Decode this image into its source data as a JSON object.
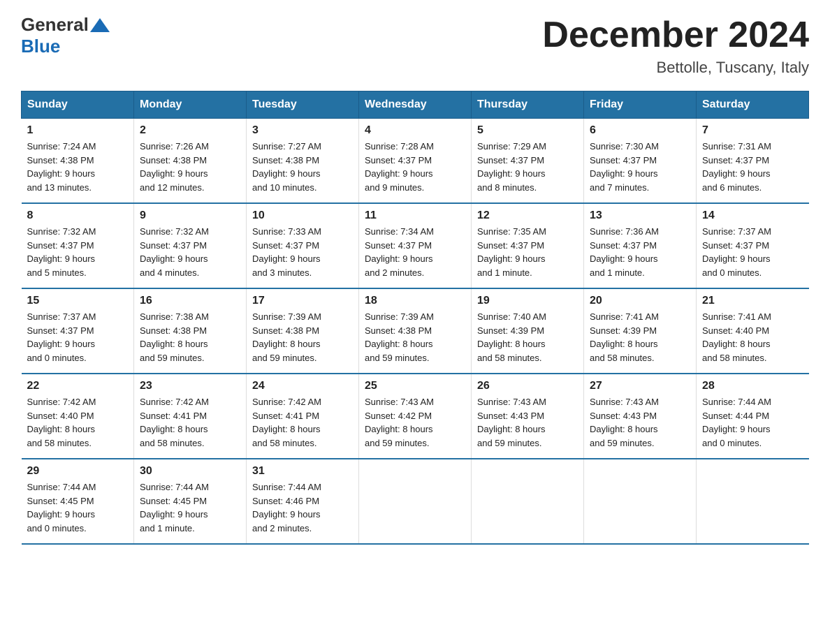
{
  "header": {
    "logo_general": "General",
    "logo_blue": "Blue",
    "month_title": "December 2024",
    "subtitle": "Bettolle, Tuscany, Italy"
  },
  "weekdays": [
    "Sunday",
    "Monday",
    "Tuesday",
    "Wednesday",
    "Thursday",
    "Friday",
    "Saturday"
  ],
  "weeks": [
    [
      {
        "day": "1",
        "sunrise": "7:24 AM",
        "sunset": "4:38 PM",
        "daylight": "9 hours and 13 minutes."
      },
      {
        "day": "2",
        "sunrise": "7:26 AM",
        "sunset": "4:38 PM",
        "daylight": "9 hours and 12 minutes."
      },
      {
        "day": "3",
        "sunrise": "7:27 AM",
        "sunset": "4:38 PM",
        "daylight": "9 hours and 10 minutes."
      },
      {
        "day": "4",
        "sunrise": "7:28 AM",
        "sunset": "4:37 PM",
        "daylight": "9 hours and 9 minutes."
      },
      {
        "day": "5",
        "sunrise": "7:29 AM",
        "sunset": "4:37 PM",
        "daylight": "9 hours and 8 minutes."
      },
      {
        "day": "6",
        "sunrise": "7:30 AM",
        "sunset": "4:37 PM",
        "daylight": "9 hours and 7 minutes."
      },
      {
        "day": "7",
        "sunrise": "7:31 AM",
        "sunset": "4:37 PM",
        "daylight": "9 hours and 6 minutes."
      }
    ],
    [
      {
        "day": "8",
        "sunrise": "7:32 AM",
        "sunset": "4:37 PM",
        "daylight": "9 hours and 5 minutes."
      },
      {
        "day": "9",
        "sunrise": "7:32 AM",
        "sunset": "4:37 PM",
        "daylight": "9 hours and 4 minutes."
      },
      {
        "day": "10",
        "sunrise": "7:33 AM",
        "sunset": "4:37 PM",
        "daylight": "9 hours and 3 minutes."
      },
      {
        "day": "11",
        "sunrise": "7:34 AM",
        "sunset": "4:37 PM",
        "daylight": "9 hours and 2 minutes."
      },
      {
        "day": "12",
        "sunrise": "7:35 AM",
        "sunset": "4:37 PM",
        "daylight": "9 hours and 1 minute."
      },
      {
        "day": "13",
        "sunrise": "7:36 AM",
        "sunset": "4:37 PM",
        "daylight": "9 hours and 1 minute."
      },
      {
        "day": "14",
        "sunrise": "7:37 AM",
        "sunset": "4:37 PM",
        "daylight": "9 hours and 0 minutes."
      }
    ],
    [
      {
        "day": "15",
        "sunrise": "7:37 AM",
        "sunset": "4:37 PM",
        "daylight": "9 hours and 0 minutes."
      },
      {
        "day": "16",
        "sunrise": "7:38 AM",
        "sunset": "4:38 PM",
        "daylight": "8 hours and 59 minutes."
      },
      {
        "day": "17",
        "sunrise": "7:39 AM",
        "sunset": "4:38 PM",
        "daylight": "8 hours and 59 minutes."
      },
      {
        "day": "18",
        "sunrise": "7:39 AM",
        "sunset": "4:38 PM",
        "daylight": "8 hours and 59 minutes."
      },
      {
        "day": "19",
        "sunrise": "7:40 AM",
        "sunset": "4:39 PM",
        "daylight": "8 hours and 58 minutes."
      },
      {
        "day": "20",
        "sunrise": "7:41 AM",
        "sunset": "4:39 PM",
        "daylight": "8 hours and 58 minutes."
      },
      {
        "day": "21",
        "sunrise": "7:41 AM",
        "sunset": "4:40 PM",
        "daylight": "8 hours and 58 minutes."
      }
    ],
    [
      {
        "day": "22",
        "sunrise": "7:42 AM",
        "sunset": "4:40 PM",
        "daylight": "8 hours and 58 minutes."
      },
      {
        "day": "23",
        "sunrise": "7:42 AM",
        "sunset": "4:41 PM",
        "daylight": "8 hours and 58 minutes."
      },
      {
        "day": "24",
        "sunrise": "7:42 AM",
        "sunset": "4:41 PM",
        "daylight": "8 hours and 58 minutes."
      },
      {
        "day": "25",
        "sunrise": "7:43 AM",
        "sunset": "4:42 PM",
        "daylight": "8 hours and 59 minutes."
      },
      {
        "day": "26",
        "sunrise": "7:43 AM",
        "sunset": "4:43 PM",
        "daylight": "8 hours and 59 minutes."
      },
      {
        "day": "27",
        "sunrise": "7:43 AM",
        "sunset": "4:43 PM",
        "daylight": "8 hours and 59 minutes."
      },
      {
        "day": "28",
        "sunrise": "7:44 AM",
        "sunset": "4:44 PM",
        "daylight": "9 hours and 0 minutes."
      }
    ],
    [
      {
        "day": "29",
        "sunrise": "7:44 AM",
        "sunset": "4:45 PM",
        "daylight": "9 hours and 0 minutes."
      },
      {
        "day": "30",
        "sunrise": "7:44 AM",
        "sunset": "4:45 PM",
        "daylight": "9 hours and 1 minute."
      },
      {
        "day": "31",
        "sunrise": "7:44 AM",
        "sunset": "4:46 PM",
        "daylight": "9 hours and 2 minutes."
      },
      null,
      null,
      null,
      null
    ]
  ],
  "labels": {
    "sunrise": "Sunrise:",
    "sunset": "Sunset:",
    "daylight": "Daylight:"
  }
}
